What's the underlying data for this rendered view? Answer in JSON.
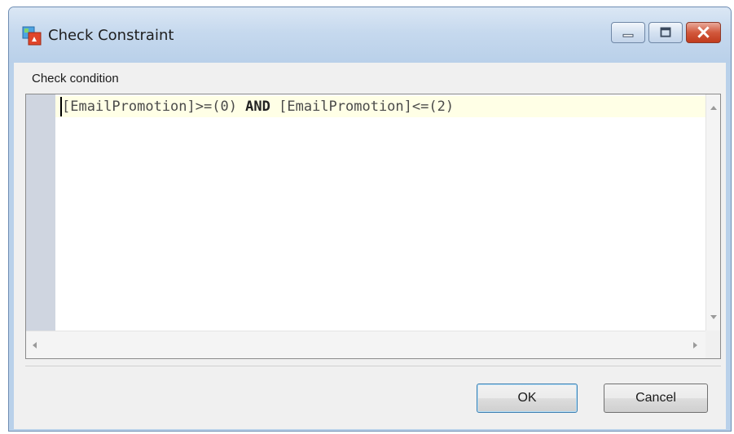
{
  "window": {
    "title": "Check Constraint",
    "app_icon": "constraint-app-icon",
    "caption_buttons": [
      "minimize-icon",
      "maximize-icon",
      "close-icon"
    ]
  },
  "form": {
    "label": "Check condition"
  },
  "editor": {
    "code_segments": [
      {
        "text": "[EmailPromotion]>=(0) ",
        "keyword": false
      },
      {
        "text": "AND",
        "keyword": true
      },
      {
        "text": " [EmailPromotion]<=(2)",
        "keyword": false
      }
    ]
  },
  "buttons": {
    "ok": "OK",
    "cancel": "Cancel"
  },
  "colors": {
    "titlebar": "#c6d9ee",
    "gutter": "#cfd5e0",
    "current_line": "#ffffe6",
    "close_button": "#d2583c"
  }
}
